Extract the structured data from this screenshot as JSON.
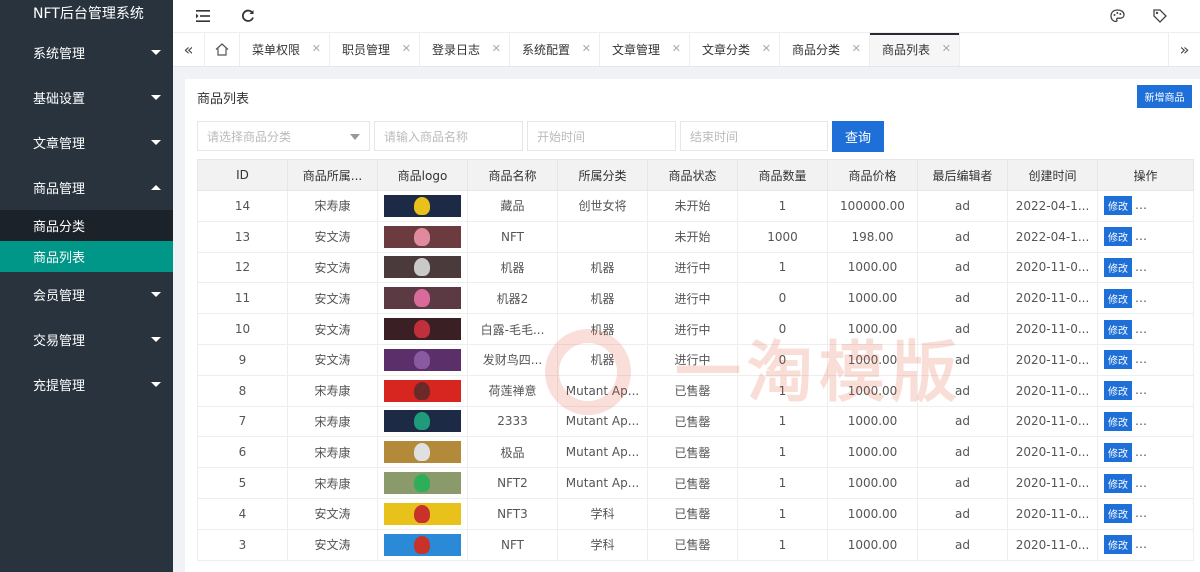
{
  "brand": "NFT后台管理系统",
  "sidebar": {
    "menus": [
      {
        "label": "系统管理"
      },
      {
        "label": "基础设置"
      },
      {
        "label": "文章管理"
      },
      {
        "label": "商品管理"
      },
      {
        "label": "会员管理"
      },
      {
        "label": "交易管理"
      },
      {
        "label": "充提管理"
      }
    ],
    "sub": [
      {
        "label": "商品分类"
      },
      {
        "label": "商品列表"
      }
    ]
  },
  "topbar": {
    "menu_icon": "menu-fold-icon",
    "refresh_icon": "refresh-icon",
    "theme_icon": "palette-icon",
    "tag_icon": "tag-icon"
  },
  "tabs": [
    {
      "label": "菜单权限"
    },
    {
      "label": "职员管理"
    },
    {
      "label": "登录日志"
    },
    {
      "label": "系统配置"
    },
    {
      "label": "文章管理"
    },
    {
      "label": "文章分类"
    },
    {
      "label": "商品分类"
    },
    {
      "label": "商品列表"
    }
  ],
  "page": {
    "title": "商品列表",
    "add_button": "新增商品"
  },
  "filters": {
    "category_placeholder": "请选择商品分类",
    "name_placeholder": "请输入商品名称",
    "start_placeholder": "开始时间",
    "end_placeholder": "结束时间",
    "search_button": "查询"
  },
  "table": {
    "headers": [
      "ID",
      "商品所属...",
      "商品logo",
      "商品名称",
      "所属分类",
      "商品状态",
      "商品数量",
      "商品价格",
      "最后编辑者",
      "创建时间",
      "操作"
    ],
    "edit_label": "修改",
    "rows": [
      {
        "id": "14",
        "owner": "宋寿康",
        "name": "藏品",
        "category": "创世女将",
        "status": "未开始",
        "qty": "1",
        "price": "100000.00",
        "editor": "ad",
        "created": "2022-04-1...",
        "bg": "#1d2a45",
        "blob": "#e8c21b"
      },
      {
        "id": "13",
        "owner": "安文涛",
        "name": "NFT",
        "category": "",
        "status": "未开始",
        "qty": "1000",
        "price": "198.00",
        "editor": "ad",
        "created": "2022-04-1...",
        "bg": "#6b3b3f",
        "blob": "#e08aa0"
      },
      {
        "id": "12",
        "owner": "安文涛",
        "name": "机器",
        "category": "机器",
        "status": "进行中",
        "qty": "1",
        "price": "1000.00",
        "editor": "ad",
        "created": "2020-11-0...",
        "bg": "#4a3a3c",
        "blob": "#c9c9c9"
      },
      {
        "id": "11",
        "owner": "安文涛",
        "name": "机器2",
        "category": "机器",
        "status": "进行中",
        "qty": "0",
        "price": "1000.00",
        "editor": "ad",
        "created": "2020-11-0...",
        "bg": "#5b3a44",
        "blob": "#d96a9a"
      },
      {
        "id": "10",
        "owner": "安文涛",
        "name": "白露-毛毛...",
        "category": "机器",
        "status": "进行中",
        "qty": "0",
        "price": "1000.00",
        "editor": "ad",
        "created": "2020-11-0...",
        "bg": "#3a1f24",
        "blob": "#c0303a"
      },
      {
        "id": "9",
        "owner": "安文涛",
        "name": "发财鸟四...",
        "category": "机器",
        "status": "进行中",
        "qty": "0",
        "price": "1000.00",
        "editor": "ad",
        "created": "2020-11-0...",
        "bg": "#5a2f6a",
        "blob": "#8a5aa0"
      },
      {
        "id": "8",
        "owner": "宋寿康",
        "name": "荷莲禅意",
        "category": "Mutant Ap...",
        "status": "已售罄",
        "qty": "1",
        "price": "1000.00",
        "editor": "ad",
        "created": "2020-11-0...",
        "bg": "#d7261f",
        "blob": "#6b2a2a"
      },
      {
        "id": "7",
        "owner": "宋寿康",
        "name": "2333",
        "category": "Mutant Ap...",
        "status": "已售罄",
        "qty": "1",
        "price": "1000.00",
        "editor": "ad",
        "created": "2020-11-0...",
        "bg": "#1d2a45",
        "blob": "#1f9a7a"
      },
      {
        "id": "6",
        "owner": "宋寿康",
        "name": "极品",
        "category": "Mutant Ap...",
        "status": "已售罄",
        "qty": "1",
        "price": "1000.00",
        "editor": "ad",
        "created": "2020-11-0...",
        "bg": "#b28a3a",
        "blob": "#e0e0e0"
      },
      {
        "id": "5",
        "owner": "宋寿康",
        "name": "NFT2",
        "category": "Mutant Ap...",
        "status": "已售罄",
        "qty": "1",
        "price": "1000.00",
        "editor": "ad",
        "created": "2020-11-0...",
        "bg": "#8a9a6a",
        "blob": "#2fae5a"
      },
      {
        "id": "4",
        "owner": "安文涛",
        "name": "NFT3",
        "category": "学科",
        "status": "已售罄",
        "qty": "1",
        "price": "1000.00",
        "editor": "ad",
        "created": "2020-11-0...",
        "bg": "#e8c21b",
        "blob": "#c8322a"
      },
      {
        "id": "3",
        "owner": "安文涛",
        "name": "NFT",
        "category": "学科",
        "status": "已售罄",
        "qty": "1",
        "price": "1000.00",
        "editor": "ad",
        "created": "2020-11-0...",
        "bg": "#2a8ad8",
        "blob": "#c8322a"
      }
    ]
  },
  "watermark": "一淘模版",
  "colors": {
    "sidebar": "#28333e",
    "active_sub": "#009688",
    "primary": "#1e6fd8"
  }
}
